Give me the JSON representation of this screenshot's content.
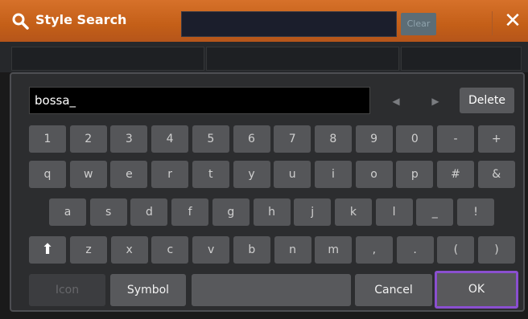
{
  "title": {
    "label": "Style Search",
    "clear_label": "Clear",
    "close_glyph": "✕"
  },
  "input": {
    "value": "bossa_"
  },
  "nav": {
    "left_glyph": "◀",
    "right_glyph": "▶",
    "delete_label": "Delete"
  },
  "rows": {
    "r1": [
      "1",
      "2",
      "3",
      "4",
      "5",
      "6",
      "7",
      "8",
      "9",
      "0",
      "-",
      "+"
    ],
    "r2": [
      "q",
      "w",
      "e",
      "r",
      "t",
      "y",
      "u",
      "i",
      "o",
      "p",
      "#",
      "&"
    ],
    "r3": [
      "a",
      "s",
      "d",
      "f",
      "g",
      "h",
      "j",
      "k",
      "l",
      "_",
      "!"
    ],
    "r4": [
      "z",
      "x",
      "c",
      "v",
      "b",
      "n",
      "m",
      ",",
      ".",
      "(",
      ")"
    ]
  },
  "shift_glyph": "⬆",
  "bottom": {
    "icon_label": "Icon",
    "symbol_label": "Symbol",
    "cancel_label": "Cancel",
    "ok_label": "OK"
  },
  "colors": {
    "title_bar": "#c45f18",
    "ok_highlight": "#8a4fd0"
  }
}
